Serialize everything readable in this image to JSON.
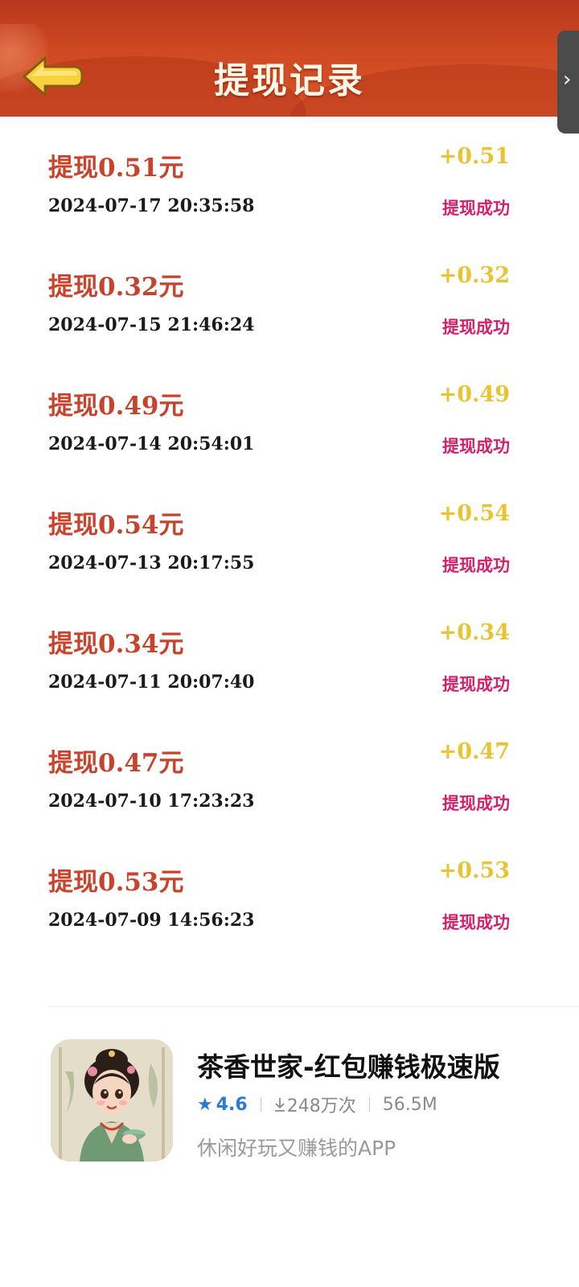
{
  "header": {
    "title": "提现记录",
    "back_icon": "back-arrow-icon",
    "side_tab_icon": "chevron-right-icon",
    "side_tab_glyph": "›"
  },
  "records": [
    {
      "title": "提现0.51元",
      "amount": "+0.51",
      "time": "2024-07-17 20:35:58",
      "status": "提现成功"
    },
    {
      "title": "提现0.32元",
      "amount": "+0.32",
      "time": "2024-07-15 21:46:24",
      "status": "提现成功"
    },
    {
      "title": "提现0.49元",
      "amount": "+0.49",
      "time": "2024-07-14 20:54:01",
      "status": "提现成功"
    },
    {
      "title": "提现0.54元",
      "amount": "+0.54",
      "time": "2024-07-13 20:17:55",
      "status": "提现成功"
    },
    {
      "title": "提现0.34元",
      "amount": "+0.34",
      "time": "2024-07-11 20:07:40",
      "status": "提现成功"
    },
    {
      "title": "提现0.47元",
      "amount": "+0.47",
      "time": "2024-07-10 17:23:23",
      "status": "提现成功"
    },
    {
      "title": "提现0.53元",
      "amount": "+0.53",
      "time": "2024-07-09 14:56:23",
      "status": "提现成功"
    }
  ],
  "app_card": {
    "name": "茶香世家-红包赚钱极速版",
    "rating": "4.6",
    "downloads": "248万次",
    "size": "56.5M",
    "description": "休闲好玩又赚钱的APP",
    "icon": "app-icon-illustration"
  },
  "colors": {
    "header_bg": "#cf4a22",
    "record_title": "#c8432b",
    "amount": "#e9c430",
    "status": "#d4206a",
    "rating": "#2a7bd6"
  }
}
